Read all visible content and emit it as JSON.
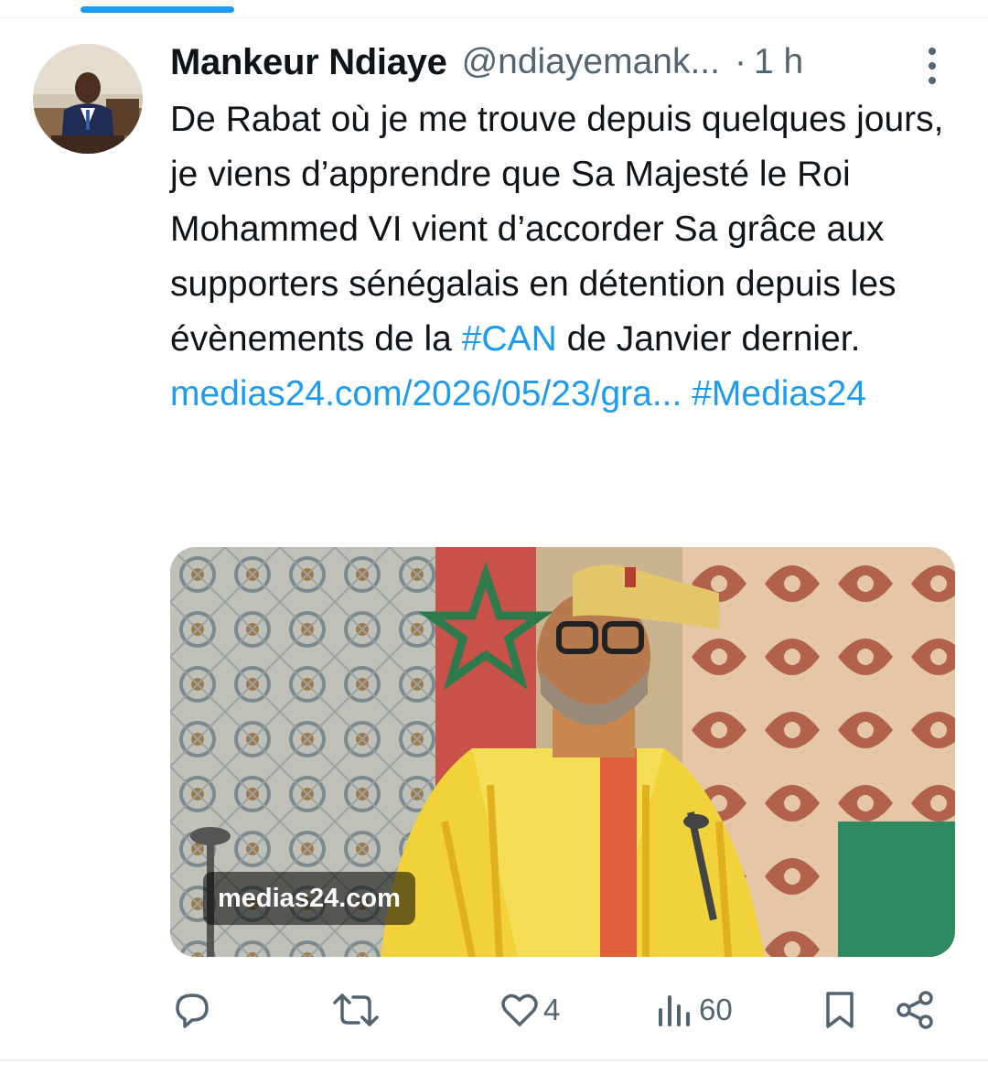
{
  "tweet": {
    "author_name": "Mankeur Ndiaye",
    "handle": "@ndiayemank...",
    "separator": "·",
    "time": "1 h",
    "text_before": "De Rabat où je me trouve depuis quelques jours, je viens d’apprendre que Sa Majesté le Roi Mohammed VI vient d’accorder Sa grâce aux supporters sénégalais en détention depuis les évènements de la ",
    "hashtag_can": "#CAN",
    "text_middle": " de Janvier dernier. ",
    "link_text": "medias24.com/2026/05/23/gra...",
    "hashtag_medias": "#Medias24"
  },
  "media": {
    "source_label": "medias24.com"
  },
  "actions": {
    "reply_icon": "reply-icon",
    "retweet_icon": "retweet-icon",
    "like_icon": "heart-icon",
    "like_count": "4",
    "views_icon": "views-icon",
    "views_count": "60",
    "bookmark_icon": "bookmark-icon",
    "share_icon": "share-icon"
  },
  "colors": {
    "accent": "#1d9bf0",
    "secondary_text": "#536471",
    "primary_text": "#0f1419"
  }
}
